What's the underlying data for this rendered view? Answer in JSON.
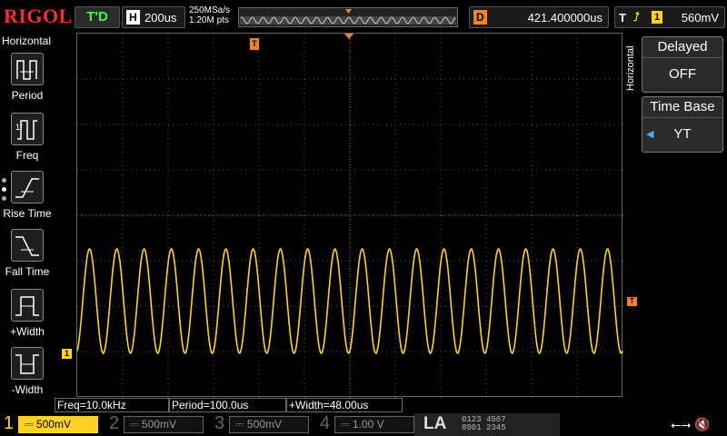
{
  "brand": "RIGOL",
  "status": "T'D",
  "horizontal": {
    "label": "H",
    "timebase": "200us"
  },
  "sample": {
    "rate": "250MSa/s",
    "points": "1.20M pts"
  },
  "delay": {
    "label": "D",
    "value": "421.400000us"
  },
  "trigger": {
    "label": "T",
    "channel": "1",
    "level": "560mV"
  },
  "left_menu": {
    "title": "Horizontal",
    "items": [
      {
        "label": "Period"
      },
      {
        "label": "Freq"
      },
      {
        "label": "Rise Time"
      },
      {
        "label": "Fall Time"
      },
      {
        "label": "+Width"
      },
      {
        "label": "-Width"
      }
    ]
  },
  "right_menu": {
    "title": "Horizontal",
    "delayed": {
      "label": "Delayed",
      "value": "OFF"
    },
    "timebase": {
      "label": "Time Base",
      "value": "YT"
    }
  },
  "measurements": {
    "freq": "Freq=10.0kHz",
    "period": "Period=100.0us",
    "width": "+Width=48.00us"
  },
  "channels": [
    {
      "num": "1",
      "scale": "500mV",
      "color": "#ffd21f"
    },
    {
      "num": "2",
      "scale": "500mV",
      "color": "#28b8c8"
    },
    {
      "num": "3",
      "scale": "500mV",
      "color": "#d23cd2"
    },
    {
      "num": "4",
      "scale": "1.00 V",
      "color": "#2e6bd6"
    }
  ],
  "la": {
    "label": "LA",
    "row1": "0123 4567",
    "row2": "8901 2345"
  },
  "markers": {
    "trigger_pos": "T",
    "ch1_marker": "1",
    "trig_level": "T"
  },
  "colors": {
    "ch1": "#ffd21f",
    "trigger": "#f58220",
    "grid": "#666666"
  }
}
